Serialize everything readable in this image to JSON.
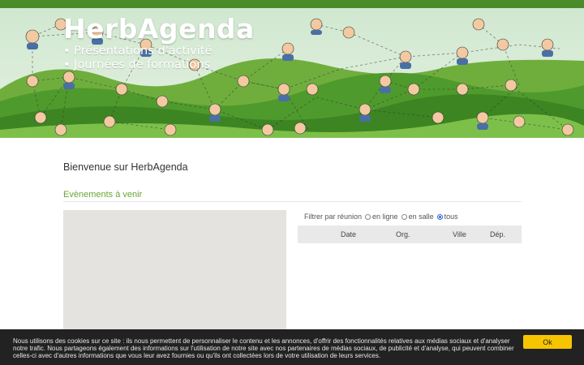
{
  "header": {
    "site_title": "HerbAgenda",
    "bullets": [
      "Présentations d'activité",
      "Journées de formations"
    ]
  },
  "main": {
    "welcome": "Bienvenue sur HerbAgenda",
    "section_title": "Evènements à venir",
    "filter": {
      "label": "Filtrer par réunion",
      "options": [
        "en ligne",
        "en salle",
        "tous"
      ],
      "selected": "tous"
    },
    "table": {
      "columns": [
        "Date",
        "Org.",
        "Ville",
        "Dép."
      ]
    }
  },
  "cookie_bar": {
    "text": "Nous utilisons des cookies sur ce site : ils nous permettent de personnaliser le contenu et les annonces, d'offrir des fonctionnalités relatives aux médias sociaux et d'analyser notre trafic. Nous partageons également des informations sur l'utilisation de notre site avec nos partenaires de médias sociaux, de publicité et d'analyse, qui peuvent combiner celles-ci avec d'autres informations que vous leur avez fournies ou qu'ils ont collectées lors de votre utilisation de leurs services.",
    "ok_label": "Ok"
  },
  "colors": {
    "accent_green": "#6aa535",
    "cookie_button": "#f7c500",
    "cookie_bg": "#222222"
  }
}
